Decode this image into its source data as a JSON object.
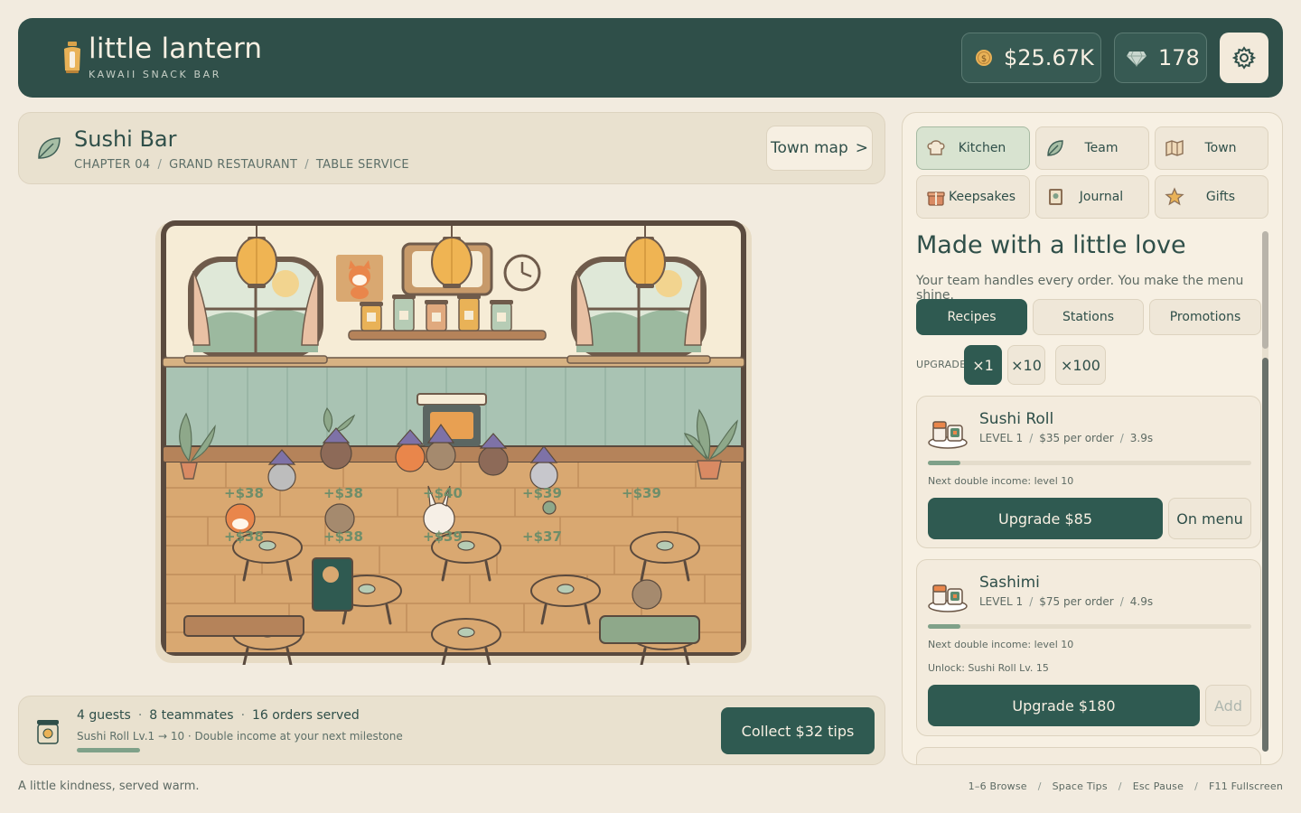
{
  "header": {
    "title": "little lantern",
    "subtitle": "KAWAII SNACK BAR",
    "coins": "$25.67K",
    "gems": "178"
  },
  "location": {
    "title": "Sushi Bar",
    "crumbs": [
      "CHAPTER 04",
      "GRAND RESTAURANT",
      "TABLE SERVICE"
    ],
    "town_map_label": "Town map",
    "town_map_chevron": ">"
  },
  "scene": {
    "floats": [
      "+$38",
      "+$38",
      "+$40",
      "+$39",
      "+$39",
      "+$38",
      "+$38",
      "+$39",
      "+$37"
    ]
  },
  "status": {
    "guests": "4 guests",
    "teammates": "8 teammates",
    "orders": "16 orders served",
    "dot": "·",
    "hint": "Sushi Roll Lv.1 → 10 · Double income at your next milestone",
    "progress": 0.1,
    "collect_label": "Collect $32 tips"
  },
  "footer": {
    "tagline": "A little kindness, served warm.",
    "shortcuts": [
      "1–6 Browse",
      "Space Tips",
      "Esc Pause",
      "F11 Fullscreen"
    ],
    "sep": "/"
  },
  "side": {
    "nav": [
      {
        "label": "Kitchen",
        "icon": "chef-hat-icon",
        "active": true
      },
      {
        "label": "Team",
        "icon": "leaf-icon",
        "active": false
      },
      {
        "label": "Town",
        "icon": "map-icon",
        "active": false
      },
      {
        "label": "Keepsakes",
        "icon": "gift-box-icon",
        "active": false
      },
      {
        "label": "Journal",
        "icon": "journal-icon",
        "active": false
      },
      {
        "label": "Gifts",
        "icon": "star-icon",
        "active": false
      }
    ],
    "title": "Made with a little love",
    "desc": "Your team handles every order. You make the menu shine.",
    "subtabs": [
      "Recipes",
      "Stations",
      "Promotions"
    ],
    "upgrade_label": "UPGRADE",
    "multipliers": [
      "×1",
      "×10",
      "×100"
    ],
    "recipes": [
      {
        "name": "Sushi Roll",
        "level": "LEVEL 1",
        "per_order": "$35 per order",
        "time": "3.9s",
        "progress": 0.1,
        "note": "Next double income: level 10",
        "upgrade_label": "Upgrade  $85",
        "side_label": "On menu"
      },
      {
        "name": "Sashimi",
        "level": "LEVEL 1",
        "per_order": "$75 per order",
        "time": "4.9s",
        "progress": 0.1,
        "note": "Next double income: level 10",
        "unlock": "Unlock: Sushi Roll Lv. 15",
        "upgrade_label": "Upgrade  $180",
        "side_label": "Add"
      }
    ],
    "meta_sep": "/"
  },
  "colors": {
    "primary": "#2f4f49",
    "button": "#2f5a51",
    "background": "#f2ebdf",
    "panel": "#e9e1cf",
    "accent_sage": "#7fa189",
    "gold": "#e9b257"
  }
}
